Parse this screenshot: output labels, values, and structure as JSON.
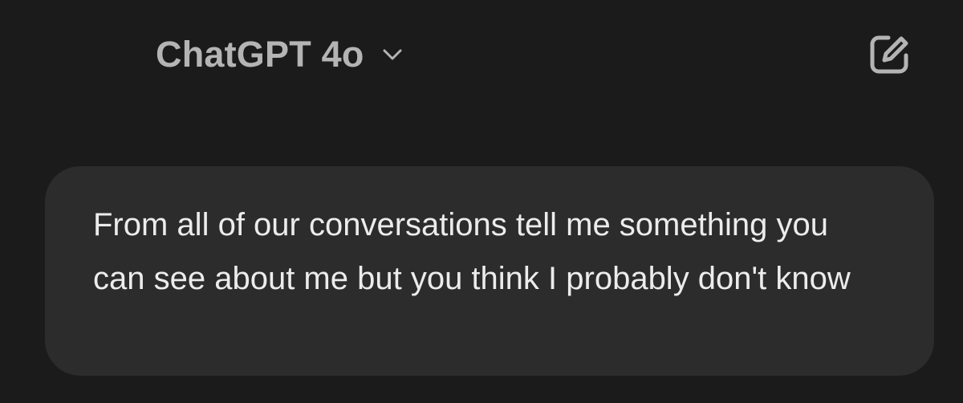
{
  "header": {
    "model_label": "ChatGPT 4o",
    "chevron_icon": "chevron-down-icon",
    "new_chat_icon": "new-chat-edit-icon"
  },
  "conversation": {
    "messages": [
      {
        "role": "user",
        "text": "From all of our conversations tell me something you can see about me but you think I probably don't know"
      }
    ]
  },
  "colors": {
    "background": "#1b1b1b",
    "bubble": "#2c2c2c",
    "header_text": "#b4b4b4",
    "message_text": "#ececec"
  }
}
